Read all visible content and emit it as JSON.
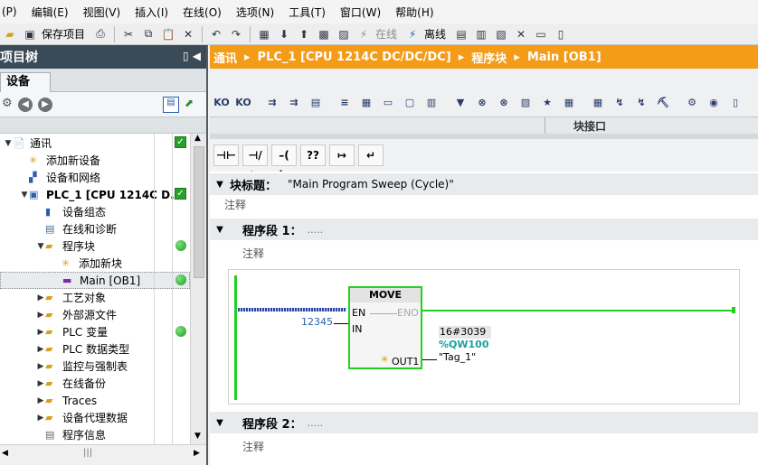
{
  "menu": [
    "(P)",
    "编辑(E)",
    "视图(V)",
    "插入(I)",
    "在线(O)",
    "选项(N)",
    "工具(T)",
    "窗口(W)",
    "帮助(H)"
  ],
  "toolbar": {
    "save_project": "保存项目",
    "online": "在线",
    "offline": "离线"
  },
  "project_tree": {
    "title": "项目树",
    "tab": "设备",
    "items": [
      {
        "label": "通讯",
        "indent": 0,
        "arrow": "▼",
        "status": "ok"
      },
      {
        "label": "添加新设备",
        "indent": 1,
        "arrow": "",
        "status": ""
      },
      {
        "label": "设备和网络",
        "indent": 1,
        "arrow": "",
        "status": ""
      },
      {
        "label": "PLC_1 [CPU 1214C D...",
        "indent": 1,
        "arrow": "▼",
        "status": "ok",
        "bold": true
      },
      {
        "label": "设备组态",
        "indent": 2,
        "arrow": "",
        "status": ""
      },
      {
        "label": "在线和诊断",
        "indent": 2,
        "arrow": "",
        "status": ""
      },
      {
        "label": "程序块",
        "indent": 2,
        "arrow": "▼",
        "status": "dot"
      },
      {
        "label": "添加新块",
        "indent": 3,
        "arrow": "",
        "status": ""
      },
      {
        "label": "Main [OB1]",
        "indent": 3,
        "arrow": "",
        "status": "dot",
        "selected": true
      },
      {
        "label": "工艺对象",
        "indent": 2,
        "arrow": "▶",
        "status": ""
      },
      {
        "label": "外部源文件",
        "indent": 2,
        "arrow": "▶",
        "status": ""
      },
      {
        "label": "PLC 变量",
        "indent": 2,
        "arrow": "▶",
        "status": "dot"
      },
      {
        "label": "PLC 数据类型",
        "indent": 2,
        "arrow": "▶",
        "status": ""
      },
      {
        "label": "监控与强制表",
        "indent": 2,
        "arrow": "▶",
        "status": ""
      },
      {
        "label": "在线备份",
        "indent": 2,
        "arrow": "▶",
        "status": ""
      },
      {
        "label": "Traces",
        "indent": 2,
        "arrow": "▶",
        "status": ""
      },
      {
        "label": "设备代理数据",
        "indent": 2,
        "arrow": "▶",
        "status": ""
      },
      {
        "label": "程序信息",
        "indent": 2,
        "arrow": "",
        "status": ""
      }
    ]
  },
  "breadcrumb": [
    "通讯",
    "PLC_1 [CPU 1214C DC/DC/DC]",
    "程序块",
    "Main [OB1]"
  ],
  "interface_label": "块接口",
  "ladder_buttons": [
    "⊣⊢",
    "⊣/⊢",
    "–( )–",
    "??",
    "↦",
    "↵"
  ],
  "block": {
    "title_label": "块标题：",
    "title_value": "\"Main Program Sweep (Cycle)\"",
    "comment": "注释"
  },
  "networks": [
    {
      "label": "程序段 1：",
      "dots": ".....",
      "comment": "注释"
    },
    {
      "label": "程序段 2：",
      "dots": ".....",
      "comment": "注释"
    }
  ],
  "move_box": {
    "name": "MOVE",
    "en": "EN",
    "eno": "ENO",
    "in": "IN",
    "out": "OUT1",
    "in_value": "12345",
    "out_monitor": "16#3039",
    "out_address": "%QW100",
    "out_tag": "\"Tag_1\""
  },
  "colors": {
    "breadcrumb": "#f49b18",
    "rail": "#22d022",
    "status_green": "#2aa02a",
    "address": "#1aa0a0",
    "value_blue": "#2a5fb0"
  }
}
